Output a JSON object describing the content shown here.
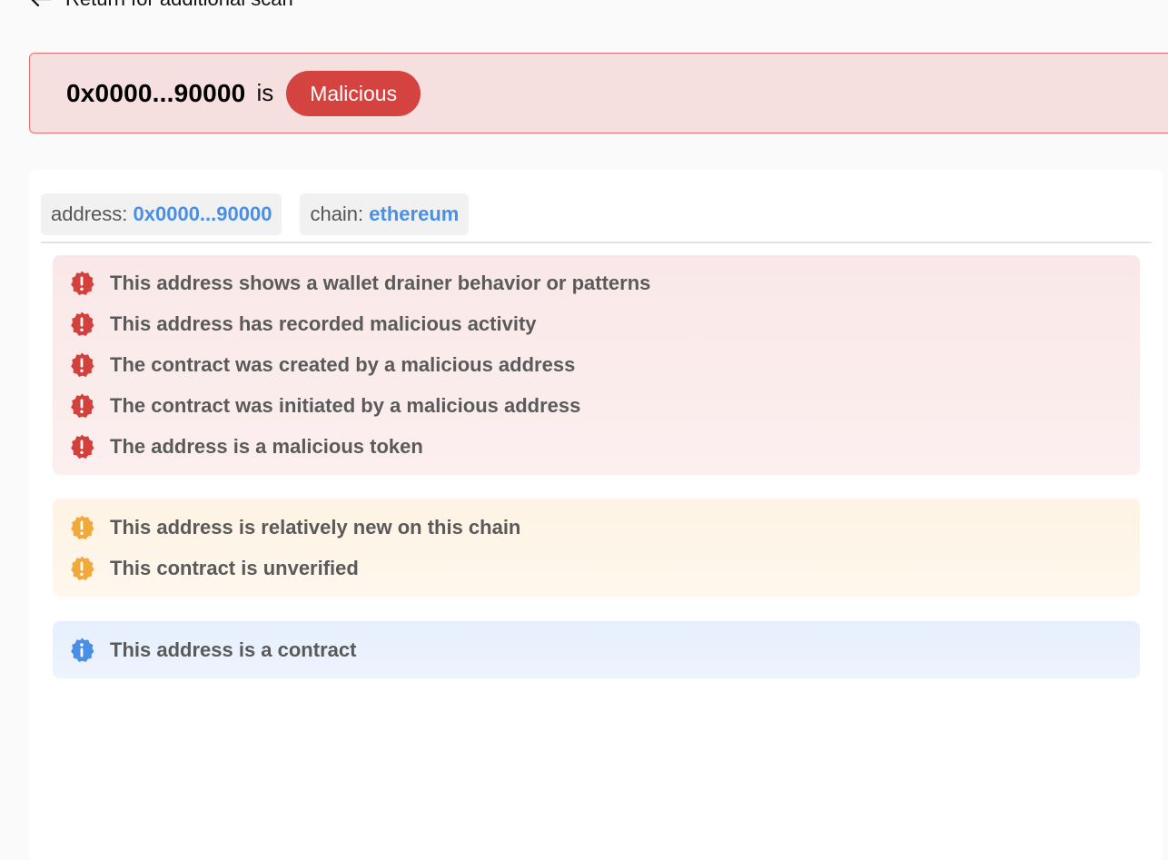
{
  "header": {
    "back_label": "Return for additional scan"
  },
  "verdict": {
    "address": "0x0000...90000",
    "is_label": "is",
    "status": "Malicious",
    "status_color": "#d4433f"
  },
  "details": {
    "address_key": "address:",
    "address_value": "0x0000...90000",
    "chain_key": "chain:",
    "chain_value": "ethereum"
  },
  "findings": {
    "danger": [
      "This address shows a wallet drainer behavior or patterns",
      "This address has recorded malicious activity",
      "The contract was created by a malicious address",
      "The contract was initiated by a malicious address",
      "The address is a malicious token"
    ],
    "warning": [
      "This address is relatively new on this chain",
      "This contract is unverified"
    ],
    "info": [
      "This address is a contract"
    ]
  },
  "colors": {
    "danger_icon": "#d3413d",
    "warning_icon": "#f2a93b",
    "info_icon": "#4a8fe6",
    "link_blue": "#4a8fe6"
  }
}
